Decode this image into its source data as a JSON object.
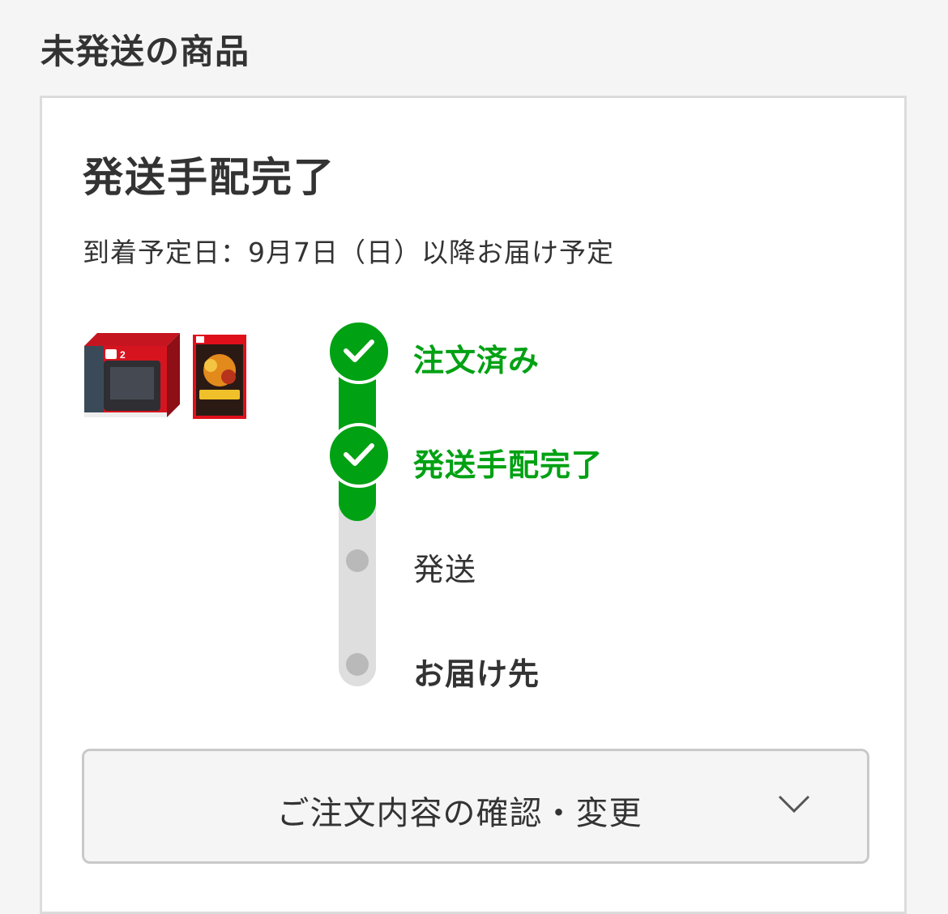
{
  "section": {
    "title": "未発送の商品"
  },
  "order": {
    "status_heading": "発送手配完了",
    "arrival": "到着予定日：9月7日（日）以降お届け予定",
    "products": [
      {
        "name": "Nintendo Switch 2",
        "icon": "console-box-image"
      },
      {
        "name": "game software",
        "icon": "game-package-image"
      }
    ],
    "progress": {
      "completed_fraction": 0.5,
      "steps": [
        {
          "label": "注文済み",
          "state": "done"
        },
        {
          "label": "発送手配完了",
          "state": "done"
        },
        {
          "label": "発送",
          "state": "pending"
        },
        {
          "label": "お届け先",
          "state": "pending"
        }
      ]
    },
    "details_button": {
      "label": "ご注文内容の確認・変更",
      "icon": "chevron-down-icon"
    }
  },
  "colors": {
    "accent_green": "#00a113",
    "pending_gray": "#b9b9b9",
    "track_gray": "#dedede"
  }
}
